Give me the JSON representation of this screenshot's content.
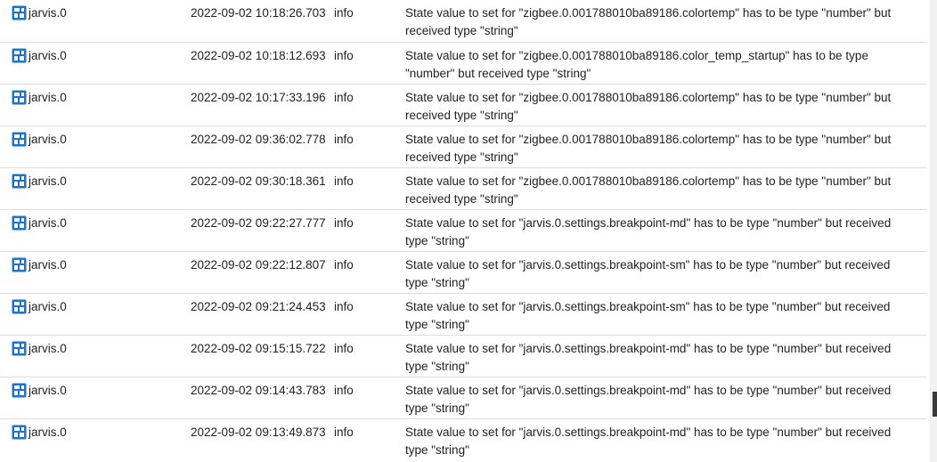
{
  "log": {
    "rows": [
      {
        "source": "jarvis.0",
        "time": "2022-09-02 10:18:26.703",
        "severity": "info",
        "message": "State value to set for \"zigbee.0.001788010ba89186.colortemp\" has to be type \"number\" but received type \"string\""
      },
      {
        "source": "jarvis.0",
        "time": "2022-09-02 10:18:12.693",
        "severity": "info",
        "message": "State value to set for \"zigbee.0.001788010ba89186.color_temp_startup\" has to be type \"number\" but received type \"string\""
      },
      {
        "source": "jarvis.0",
        "time": "2022-09-02 10:17:33.196",
        "severity": "info",
        "message": "State value to set for \"zigbee.0.001788010ba89186.colortemp\" has to be type \"number\" but received type \"string\""
      },
      {
        "source": "jarvis.0",
        "time": "2022-09-02 09:36:02.778",
        "severity": "info",
        "message": "State value to set for \"zigbee.0.001788010ba89186.colortemp\" has to be type \"number\" but received type \"string\""
      },
      {
        "source": "jarvis.0",
        "time": "2022-09-02 09:30:18.361",
        "severity": "info",
        "message": "State value to set for \"zigbee.0.001788010ba89186.colortemp\" has to be type \"number\" but received type \"string\""
      },
      {
        "source": "jarvis.0",
        "time": "2022-09-02 09:22:27.777",
        "severity": "info",
        "message": "State value to set for \"jarvis.0.settings.breakpoint-md\" has to be type \"number\" but received type \"string\""
      },
      {
        "source": "jarvis.0",
        "time": "2022-09-02 09:22:12.807",
        "severity": "info",
        "message": "State value to set for \"jarvis.0.settings.breakpoint-sm\" has to be type \"number\" but received type \"string\""
      },
      {
        "source": "jarvis.0",
        "time": "2022-09-02 09:21:24.453",
        "severity": "info",
        "message": "State value to set for \"jarvis.0.settings.breakpoint-sm\" has to be type \"number\" but received type \"string\""
      },
      {
        "source": "jarvis.0",
        "time": "2022-09-02 09:15:15.722",
        "severity": "info",
        "message": "State value to set for \"jarvis.0.settings.breakpoint-md\" has to be type \"number\" but received type \"string\""
      },
      {
        "source": "jarvis.0",
        "time": "2022-09-02 09:14:43.783",
        "severity": "info",
        "message": "State value to set for \"jarvis.0.settings.breakpoint-md\" has to be type \"number\" but received type \"string\""
      },
      {
        "source": "jarvis.0",
        "time": "2022-09-02 09:13:49.873",
        "severity": "info",
        "message": "State value to set for \"jarvis.0.settings.breakpoint-md\" has to be type \"number\" but received type \"string\""
      }
    ],
    "source_icon": "adapter-icon",
    "colors": {
      "icon_blue": "#1e74c9",
      "row_divider": "#dcdcdc",
      "text": "#222222"
    }
  }
}
